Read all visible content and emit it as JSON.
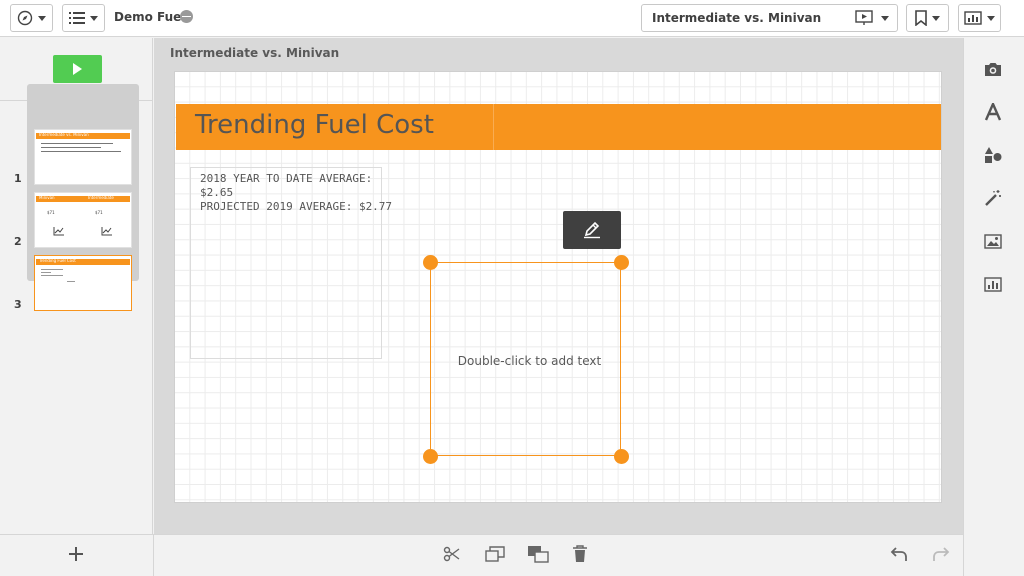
{
  "app": {
    "title": "Demo Fuel"
  },
  "story": {
    "selector_label": "Intermediate vs. Minivan"
  },
  "canvas": {
    "title": "Intermediate vs. Minivan"
  },
  "slide": {
    "banner_title": "Trending Fuel Cost",
    "text_lines": [
      "2018 YEAR TO DATE AVERAGE:",
      "$2.65",
      "PROJECTED 2019 AVERAGE: $2.77"
    ],
    "placeholder": "Double-click to add text"
  },
  "thumbnails": [
    {
      "number": "1",
      "label": "Intermediate vs. Minivan"
    },
    {
      "number": "2",
      "label_left": "Minivan",
      "label_right": "Intermediate",
      "mini_value_left": "$71",
      "mini_value_right": "$71"
    },
    {
      "number": "3",
      "label": "Trending Fuel Cost"
    }
  ],
  "icons": {
    "navigation": "compass-icon",
    "list": "list-icon",
    "status": "offline-icon",
    "present": "presentation-icon",
    "bookmark": "bookmark-icon",
    "sheets": "chart-icon",
    "edit": "pencil-icon",
    "snapshot": "camera-icon",
    "text": "text-icon",
    "shapes": "shapes-icon",
    "effects": "magic-wand-icon",
    "media": "image-icon",
    "sheet": "sheet-chart-icon",
    "add": "plus-icon",
    "cut": "scissors-icon",
    "duplicate": "copy-icon",
    "bring_to_front": "layers-icon",
    "delete": "trash-icon",
    "undo": "undo-icon",
    "redo": "redo-icon"
  },
  "colors": {
    "accent": "#f7941d",
    "play": "#52cc52"
  }
}
